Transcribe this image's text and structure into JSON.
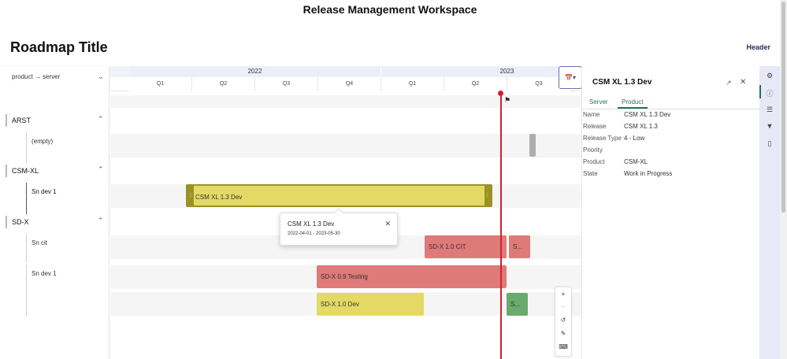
{
  "app": {
    "window_title": "Release Management Workspace",
    "roadmap_title": "Roadmap Title",
    "header_link": "Header"
  },
  "grouping": {
    "label": "product → server",
    "icon": "chevron-down-icon"
  },
  "timeline": {
    "years": [
      "2022",
      "2023"
    ],
    "quarters": [
      "Q1",
      "Q2",
      "Q3",
      "Q4",
      "Q1",
      "Q2",
      "Q3"
    ],
    "today_marker": "flag-icon"
  },
  "groups": [
    {
      "name": "ARST",
      "icon": "chevron-up-icon",
      "subrows": [
        "(empty)"
      ]
    },
    {
      "name": "CSM-XL",
      "icon": "chevron-up-icon",
      "subrows": [
        "Sn dev 1"
      ]
    },
    {
      "name": "SD-X",
      "icon": "chevron-up-icon",
      "subrows": [
        "Sn cit",
        "Sn dev 1"
      ]
    }
  ],
  "bars": [
    {
      "label": "",
      "color": "#a9b0ae"
    },
    {
      "label": "CSM XL 1.3 Dev",
      "color": "#e3d964",
      "selected": true
    },
    {
      "label": "SD-X 1.0 CIT",
      "color": "#de7a78"
    },
    {
      "label": "S...",
      "color": "#de7a78"
    },
    {
      "label": "SD-X 0.9 Testing",
      "color": "#de7a78"
    },
    {
      "label": "SD-X 1.0 Dev",
      "color": "#e3d964"
    },
    {
      "label": "S...",
      "color": "#6aaa6c"
    }
  ],
  "tooltip": {
    "title": "CSM XL 1.3 Dev",
    "dates": "2022-04-01 - 2023-05-30",
    "close_icon": "close-icon"
  },
  "detail": {
    "title": "CSM XL 1.3 Dev",
    "tabs": [
      "Server",
      "Product"
    ],
    "active_tab": "Product",
    "properties": [
      {
        "key": "Name",
        "value": "CSM XL 1.3 Dev"
      },
      {
        "key": "Release",
        "value": "CSM XL 1.3"
      },
      {
        "key": "Release Type",
        "value": "4 - Low"
      },
      {
        "key": "Priority",
        "value": ""
      },
      {
        "key": "Product",
        "value": "CSM-XL"
      },
      {
        "key": "State",
        "value": "Work in Progress"
      }
    ]
  },
  "colors": {
    "accent": "#2d6e55",
    "today": "#d61f2c",
    "header_band": "#edeef7",
    "rail": "#e8e8f6"
  }
}
